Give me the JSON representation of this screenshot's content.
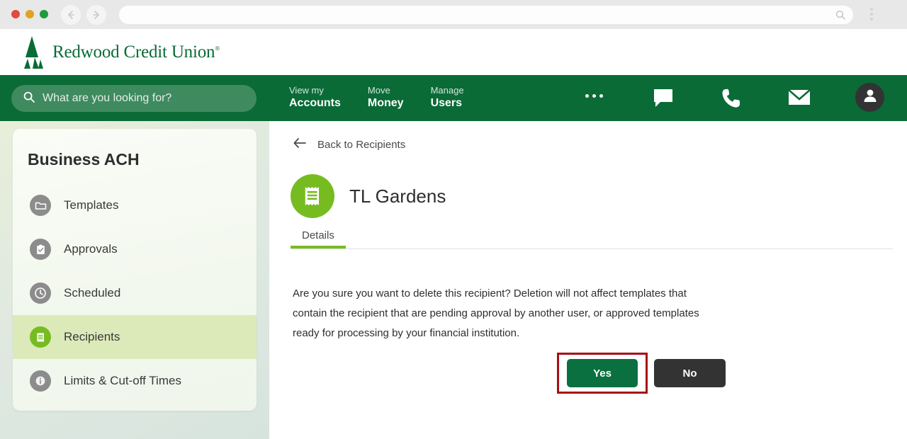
{
  "browser": {
    "back_icon": "arrow-left-icon",
    "forward_icon": "arrow-right-icon",
    "address_value": "",
    "address_placeholder": "",
    "address_search_icon": "search-icon",
    "menu_icon": "kebab-menu-icon"
  },
  "header": {
    "logo_icon": "redwood-tree-logo",
    "brand_name": "Redwood Credit Union",
    "brand_trademark": "®"
  },
  "nav": {
    "background_color": "#0a6b37",
    "search": {
      "icon": "search-icon",
      "value": "",
      "placeholder": "What are you looking for?"
    },
    "items": [
      {
        "top": "View my",
        "bottom": "Accounts"
      },
      {
        "top": "Move",
        "bottom": "Money"
      },
      {
        "top": "Manage",
        "bottom": "Users"
      }
    ],
    "more_icon": "ellipsis-icon",
    "chat_icon": "chat-bubble-icon",
    "phone_icon": "phone-icon",
    "mail_icon": "envelope-icon",
    "account_icon": "user-avatar-icon"
  },
  "sidebar": {
    "title": "Business ACH",
    "active_color": "#76bc21",
    "items": [
      {
        "label": "Templates",
        "icon": "folder-icon",
        "active": false
      },
      {
        "label": "Approvals",
        "icon": "clipboard-check-icon",
        "active": false
      },
      {
        "label": "Scheduled",
        "icon": "clock-icon",
        "active": false
      },
      {
        "label": "Recipients",
        "icon": "receipt-icon",
        "active": true
      },
      {
        "label": "Limits & Cut-off Times",
        "icon": "info-icon",
        "active": false
      }
    ]
  },
  "main": {
    "back_link": {
      "label": "Back to Recipients",
      "icon": "arrow-left-icon"
    },
    "recipient": {
      "name": "TL Gardens",
      "icon": "receipt-icon"
    },
    "tabs": [
      {
        "label": "Details",
        "active": true
      }
    ],
    "confirm_message": "Are you sure you want to delete this recipient? Deletion will not affect templates that contain the recipient that are pending approval by another user, or approved templates ready for processing by your financial institution.",
    "buttons": {
      "yes_label": "Yes",
      "no_label": "No",
      "yes_color": "#0a7040",
      "no_color": "#333333",
      "highlight_color": "#a80e13"
    }
  }
}
